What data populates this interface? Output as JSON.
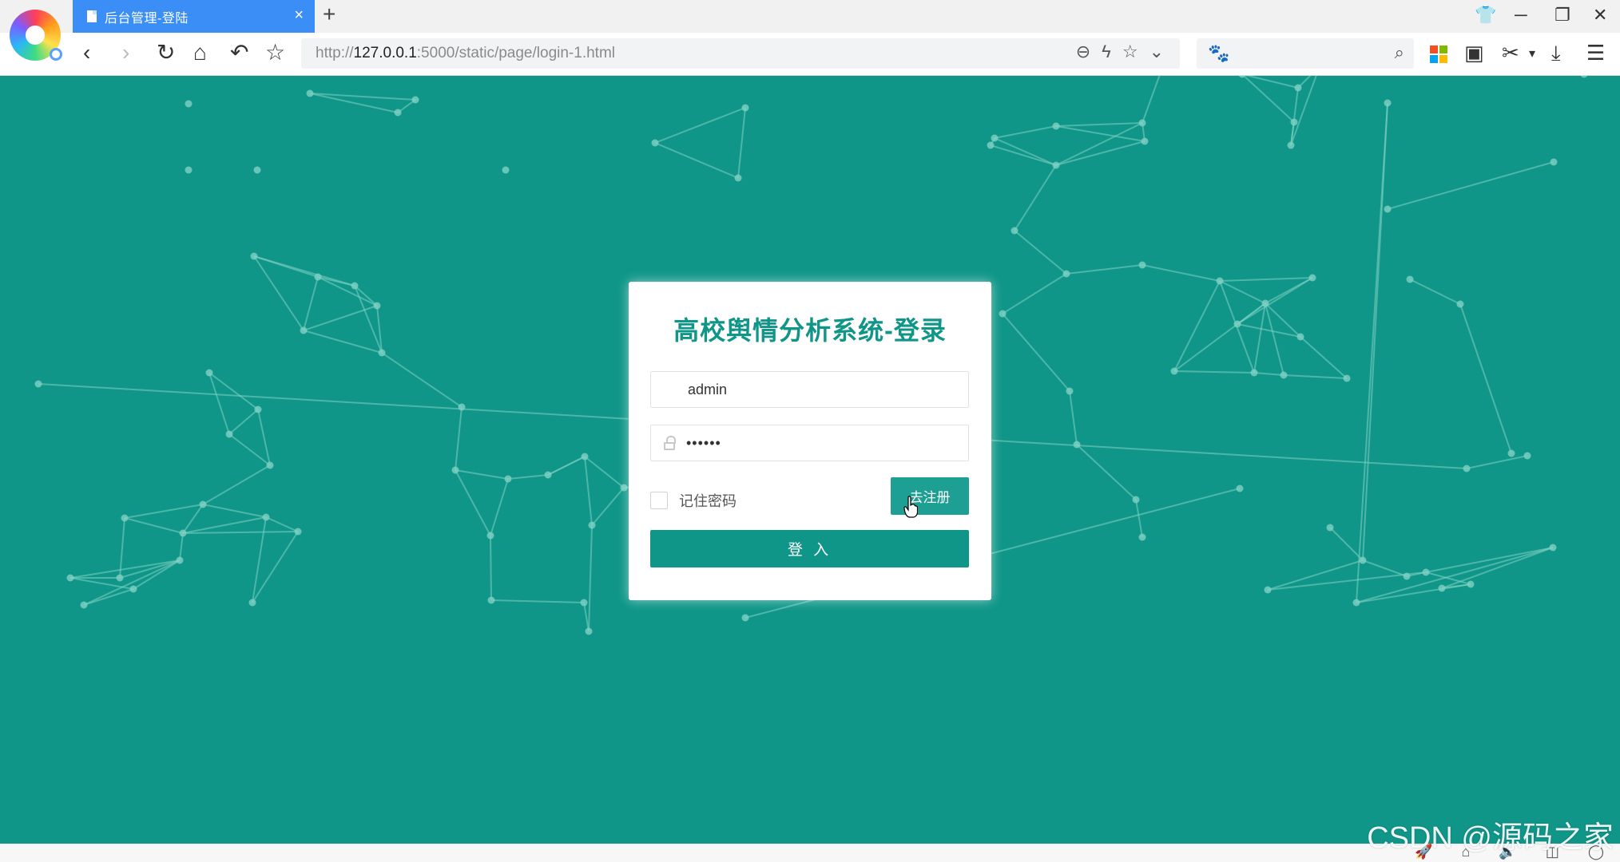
{
  "browser": {
    "tab_title": "后台管理-登陆",
    "tab_close": "×",
    "new_tab": "+",
    "url_prefix": "http://",
    "url_host": "127.0.0.1",
    "url_path": ":5000/static/page/login-1.html",
    "window_controls": {
      "skin": "👕",
      "minimize": "─",
      "restore": "❐",
      "close": "✕"
    },
    "nav": {
      "back": "‹",
      "forward": "›",
      "reload": "↻",
      "home": "⌂",
      "undo": "↶",
      "favorite": "☆"
    },
    "address_icons": {
      "zoom": "⊖",
      "lightning": "ϟ",
      "star": "☆",
      "dropdown": "⌄"
    },
    "search_icons": {
      "engine": "🐾",
      "search": "⌕"
    },
    "tools": {
      "reader": "▣",
      "cut": "✂",
      "cut_dropdown": "▾",
      "download": "⤓",
      "menu": "☰"
    }
  },
  "login": {
    "title": "高校舆情分析系统-登录",
    "username_value": "admin",
    "password_value": "••••••",
    "remember_label": "记住密码",
    "register_button": "去注册",
    "login_button": "登 入"
  },
  "watermark": "CSDN @源码之家",
  "status_icons": [
    "🚀",
    "⌂",
    "🔈",
    "◫",
    "◯"
  ],
  "colors": {
    "background": "#0f9688",
    "accent": "#0f9688",
    "register_button": "#1e9f93",
    "tab_active": "#3a8ef6",
    "particles": "#7fd1c3"
  }
}
